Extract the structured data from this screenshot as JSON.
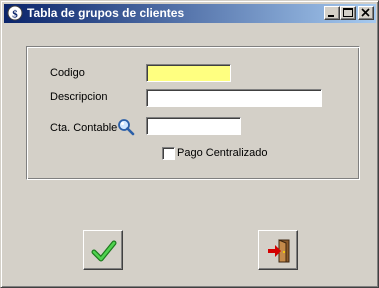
{
  "window": {
    "title": "Tabla de grupos de clientes",
    "icon": "dollar-app-icon",
    "controls": [
      "minimize-icon",
      "maximize-icon",
      "close-icon"
    ]
  },
  "form": {
    "codigo": {
      "label": "Codigo",
      "value": "",
      "highlight_color": "#ffff80"
    },
    "descripcion": {
      "label": "Descripcion",
      "value": ""
    },
    "cta_contable": {
      "label": "Cta. Contable",
      "value": "",
      "lookup_icon": "search-icon"
    },
    "pago_centralizado": {
      "label": "Pago Centralizado",
      "checked": false
    }
  },
  "actions": {
    "ok": {
      "icon": "green-checkmark-icon",
      "color": "#2fa52f"
    },
    "exit": {
      "icon": "exit-door-icon",
      "color": "#c00000"
    }
  },
  "colors": {
    "title_gradient_start": "#0a246a",
    "title_gradient_end": "#a6caf0",
    "face": "#d4d0c8"
  }
}
